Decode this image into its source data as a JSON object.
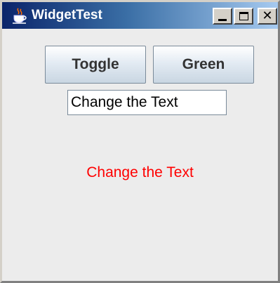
{
  "window": {
    "title": "WidgetTest",
    "app_icon": "java-coffee-cup-icon",
    "controls": {
      "minimize": "minimize-icon",
      "maximize": "maximize-icon",
      "close": "close-icon"
    }
  },
  "buttons": {
    "toggle_label": "Toggle",
    "color_label": "Green"
  },
  "text_field": {
    "value": "Change the Text"
  },
  "output_label": {
    "text": "Change the Text",
    "color": "#ff0000"
  },
  "colors": {
    "title_bar_start": "#0a246a",
    "title_bar_end": "#a6caf0",
    "panel_background": "#ececec",
    "label_text": "#ff0000"
  }
}
